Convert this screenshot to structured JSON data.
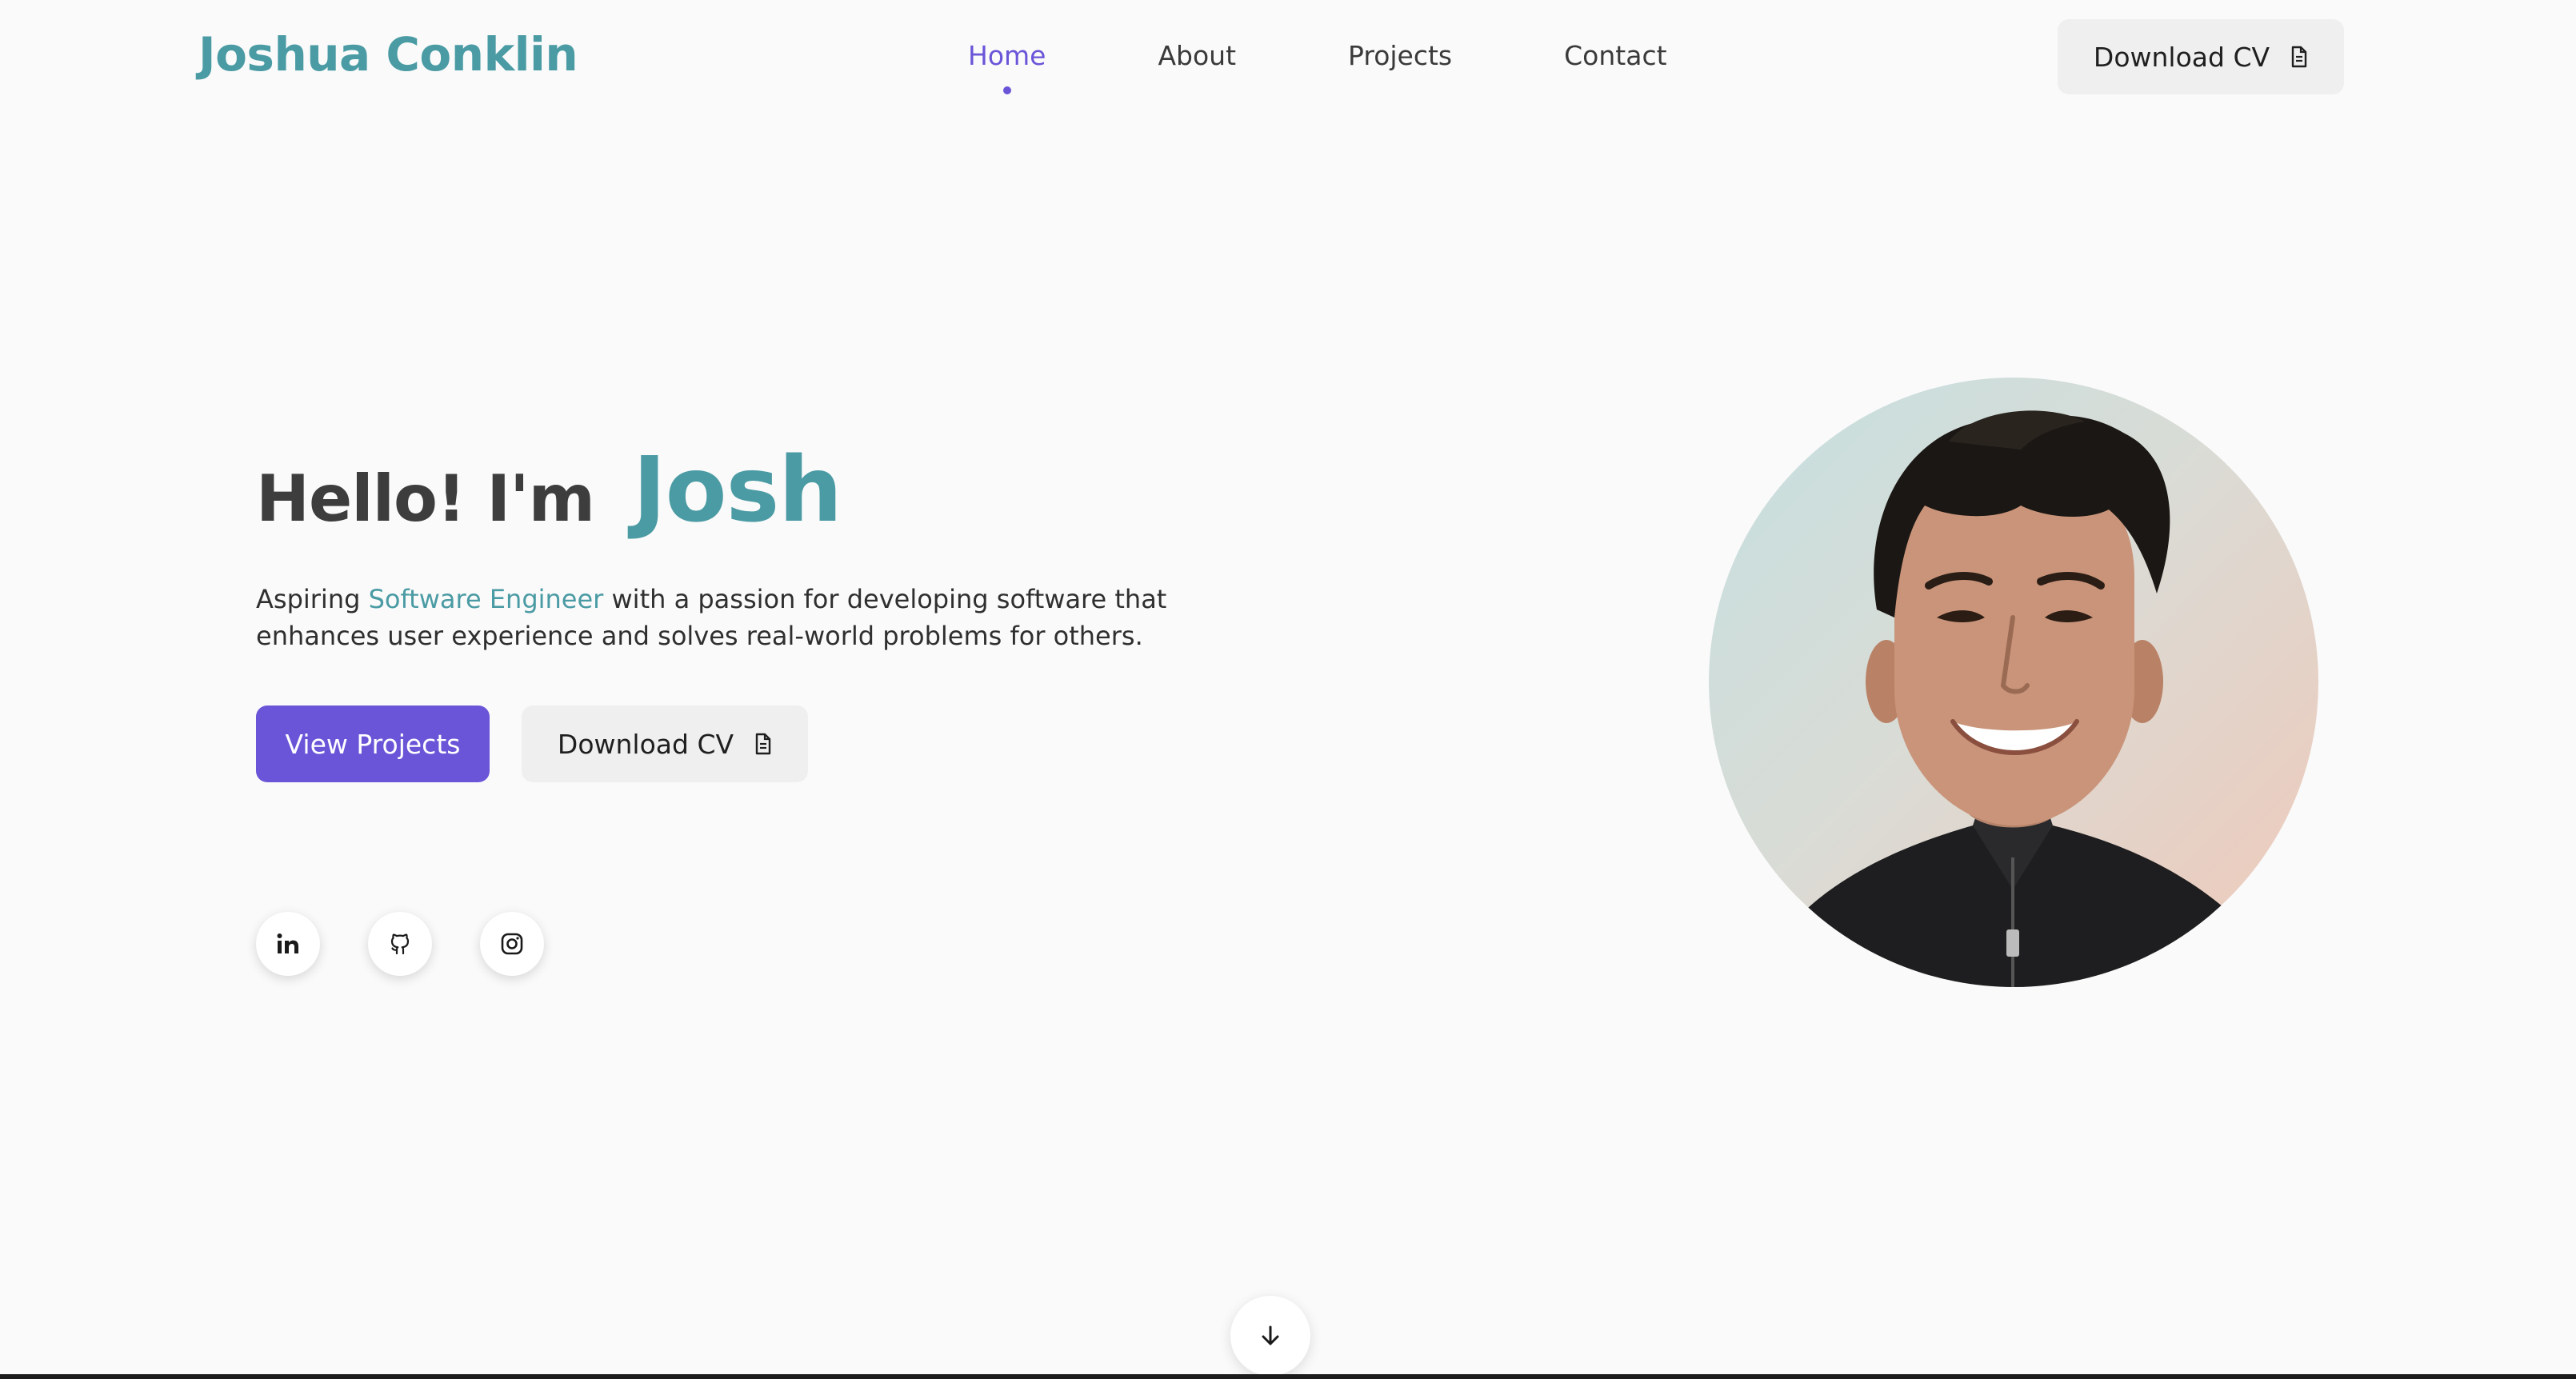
{
  "nav": {
    "brand": "Joshua Conklin",
    "links": [
      {
        "label": "Home",
        "active": true
      },
      {
        "label": "About",
        "active": false
      },
      {
        "label": "Projects",
        "active": false
      },
      {
        "label": "Contact",
        "active": false
      }
    ],
    "cv_button": {
      "label": "Download CV",
      "icon": "document-icon"
    }
  },
  "hero": {
    "greeting": "Hello! I'm",
    "name": "Josh",
    "tagline_prefix": "Aspiring",
    "tagline_highlight": "Software Engineer",
    "tagline_suffix": "with a passion for developing software that enhances user experience and solves real-world problems for others.",
    "primary_button": "View Projects",
    "secondary_button": {
      "label": "Download CV",
      "icon": "document-icon"
    },
    "socials": [
      {
        "name": "linkedin-icon"
      },
      {
        "name": "github-icon"
      },
      {
        "name": "instagram-icon"
      }
    ],
    "portrait": {
      "icon": "profile-photo"
    }
  },
  "scroll_button": {
    "icon": "arrow-down-icon"
  },
  "colors": {
    "accent_teal": "#4a9ba4",
    "accent_purple": "#6a55d8",
    "background": "#fafafa",
    "button_gray": "#efefef"
  }
}
